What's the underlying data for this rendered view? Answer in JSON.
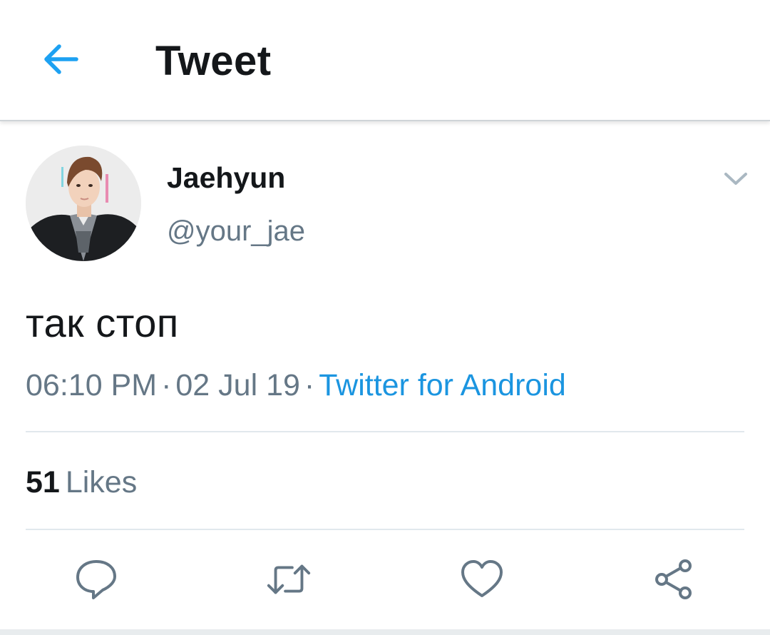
{
  "header": {
    "title": "Tweet",
    "back_icon": "arrow-left-icon",
    "accent_color": "#1da1f2"
  },
  "author": {
    "name": "Jaehyun",
    "handle": "@your_jae",
    "menu_icon": "chevron-down-icon"
  },
  "tweet": {
    "text": "так стоп",
    "time": "06:10 PM",
    "date": "02 Jul 19",
    "separator": "·",
    "source": "Twitter for Android"
  },
  "stats": {
    "likes_count": "51",
    "likes_label": "Likes"
  },
  "actions": [
    {
      "name": "reply",
      "icon": "reply-icon"
    },
    {
      "name": "retweet",
      "icon": "retweet-icon"
    },
    {
      "name": "like",
      "icon": "heart-icon"
    },
    {
      "name": "share",
      "icon": "share-icon"
    }
  ],
  "colors": {
    "text": "#14171a",
    "secondary": "#657786",
    "link": "#1b95e0",
    "divider": "#e1e8ed"
  }
}
